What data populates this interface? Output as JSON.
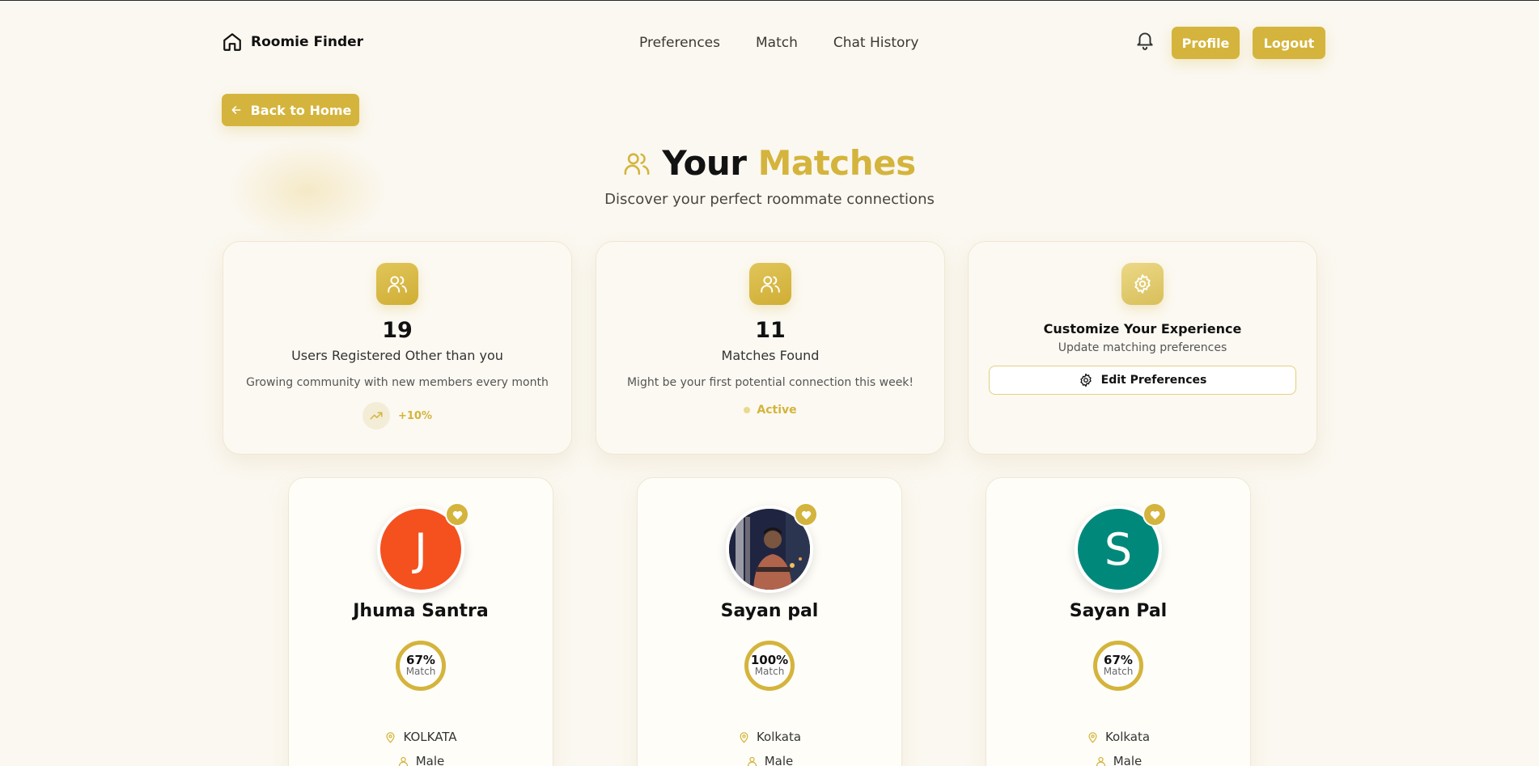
{
  "brand": {
    "name": "Roomie Finder",
    "icon": "home-icon"
  },
  "nav": {
    "links": [
      "Preferences",
      "Match",
      "Chat History"
    ]
  },
  "header_actions": {
    "profile": "Profile",
    "logout": "Logout",
    "notification_icon": "bell-icon"
  },
  "back_button": "Back to Home",
  "heading": {
    "part1": "Your",
    "part2": "Matches",
    "subtitle": "Discover your perfect roommate connections"
  },
  "stats": [
    {
      "number": "19",
      "label": "Users Registered Other than you",
      "desc": "Growing community with new members every month",
      "trend": "+10%"
    },
    {
      "number": "11",
      "label": "Matches Found",
      "desc": "Might be your first potential connection this week!",
      "status": "Active"
    },
    {
      "title": "Customize Your Experience",
      "subtitle": "Update matching preferences",
      "button": "Edit Preferences"
    }
  ],
  "matches": [
    {
      "initial": "J",
      "name": "Jhuma Santra",
      "match_pct": "67%",
      "match_label": "Match",
      "location": "KOLKATA",
      "gender": "Male",
      "avatar_color": "#f4511e"
    },
    {
      "initial": "",
      "name": "Sayan pal",
      "match_pct": "100%",
      "match_label": "Match",
      "location": "Kolkata",
      "gender": "Male",
      "avatar_color": "#3a2a33"
    },
    {
      "initial": "S",
      "name": "Sayan Pal",
      "match_pct": "67%",
      "match_label": "Match",
      "location": "Kolkata",
      "gender": "Male",
      "avatar_color": "#00897b"
    }
  ],
  "colors": {
    "accent": "#d4b43c",
    "background": "#fbf8f1"
  }
}
